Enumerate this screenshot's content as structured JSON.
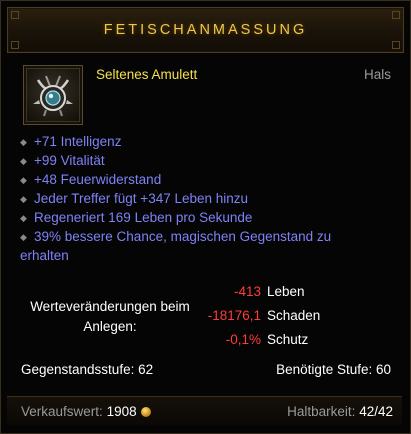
{
  "item": {
    "name": "FETISCHANMASSUNG",
    "type": "Seltenes Amulett",
    "slot": "Hals"
  },
  "affixes": [
    "+71 Intelligenz",
    "+99 Vitalität",
    "+48 Feuerwiderstand",
    "Jeder Treffer fügt +347 Leben hinzu",
    "Regeneriert 169 Leben pro Sekunde",
    "39% bessere Chance, magischen Gegenstand zu",
    "erhalten"
  ],
  "stat_changes": {
    "label": "Werteveränderungen beim Anlegen:",
    "rows": [
      {
        "value": "-413",
        "name": "Leben"
      },
      {
        "value": "-18176,1",
        "name": "Schaden"
      },
      {
        "value": "-0,1%",
        "name": "Schutz"
      }
    ]
  },
  "levels": {
    "item_level": "Gegenstandsstufe: 62",
    "required_level": "Benötigte Stufe: 60"
  },
  "footer": {
    "sell_label": "Verkaufswert:",
    "sell_value": "1908",
    "durability_label": "Haltbarkeit:",
    "durability_value": "42/42"
  },
  "colors": {
    "title": "#f0c64a",
    "rare": "#f5e04c",
    "affix": "#7f82f5",
    "negative": "#ff3b3b"
  },
  "icons": [
    "amulet-icon",
    "gold-coin-icon",
    "affix-bullet-icon"
  ]
}
